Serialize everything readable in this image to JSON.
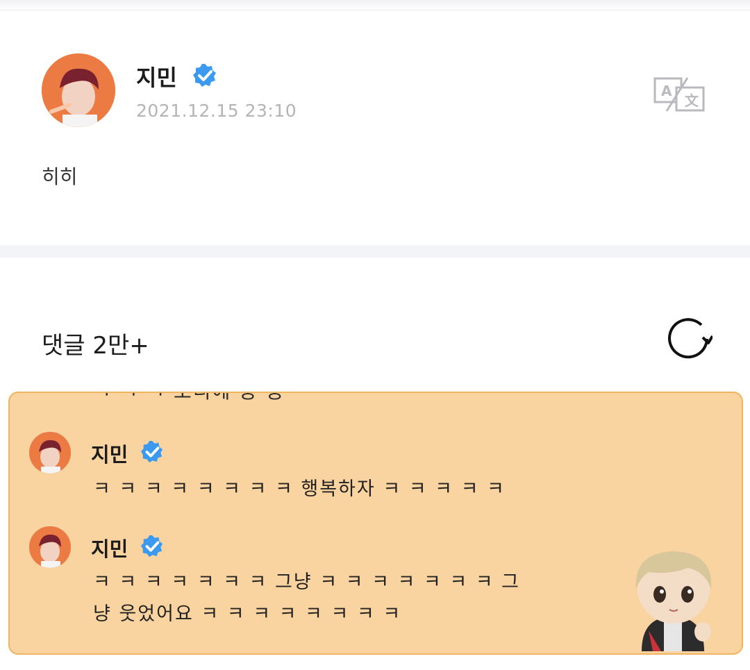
{
  "post": {
    "author": "지민",
    "timestamp": "2021.12.15 23:10",
    "text": "히히",
    "icons": {
      "verified": "verified-badge-icon",
      "translate": "translate-icon"
    }
  },
  "comments_section": {
    "title": "댓글 2만+",
    "refresh_icon": "refresh-icon",
    "clipped_text": "ㅋ ㅋ ㅋ 오디에 웅 웅",
    "comments": [
      {
        "author": "지민",
        "text": "ㅋ ㅋ ㅋ ㅋ ㅋ ㅋ ㅋ ㅋ 행복하자 ㅋ ㅋ ㅋ ㅋ ㅋ"
      },
      {
        "author": "지민",
        "text": "ㅋ ㅋ ㅋ ㅋ ㅋ ㅋ ㅋ 그냥 ㅋ ㅋ ㅋ ㅋ ㅋ ㅋ ㅋ 그냥 웃었어요 ㅋ ㅋ ㅋ ㅋ ㅋ ㅋ ㅋ ㅋ"
      }
    ]
  },
  "colors": {
    "panel_bg": "#f9d3a0",
    "panel_border": "#efb45d",
    "verified": "#3b9af0",
    "timestamp": "#b3b3b8"
  }
}
